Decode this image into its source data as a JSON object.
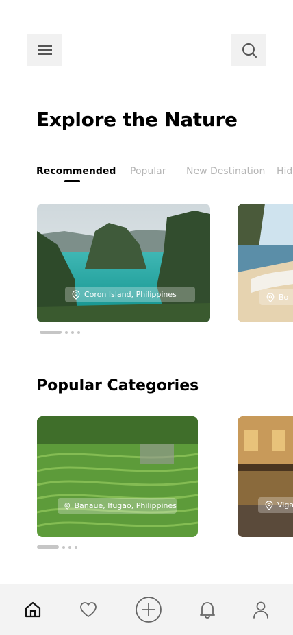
{
  "header": {
    "menu_icon": "hamburger-menu-icon",
    "search_icon": "search-icon"
  },
  "page": {
    "title": "Explore the Nature"
  },
  "tabs": [
    {
      "label": "Recommended",
      "active": true
    },
    {
      "label": "Popular",
      "active": false
    },
    {
      "label": "New Destination",
      "active": false
    },
    {
      "label": "Hidden",
      "active": false
    }
  ],
  "recommended": {
    "cards": [
      {
        "location": "Coron Island, Philippines",
        "icon": "location-pin-icon"
      },
      {
        "location": "Bo",
        "icon": "location-pin-icon"
      }
    ]
  },
  "categories": {
    "title": "Popular Categories",
    "cards": [
      {
        "location": "Banaue, Ifugao, Philippines",
        "icon": "location-pin-icon"
      },
      {
        "location": "Vigan",
        "icon": "location-pin-icon"
      }
    ]
  },
  "bottom_nav": [
    {
      "name": "home",
      "icon": "home-icon",
      "active": true
    },
    {
      "name": "favorites",
      "icon": "heart-icon",
      "active": false
    },
    {
      "name": "add",
      "icon": "plus-circle-icon",
      "active": false
    },
    {
      "name": "notifications",
      "icon": "bell-icon",
      "active": false
    },
    {
      "name": "profile",
      "icon": "user-icon",
      "active": false
    }
  ],
  "colors": {
    "text_primary": "#000000",
    "text_muted": "#b5b5b5",
    "button_bg": "#f1f1f1",
    "nav_bg": "#f3f3f3"
  }
}
